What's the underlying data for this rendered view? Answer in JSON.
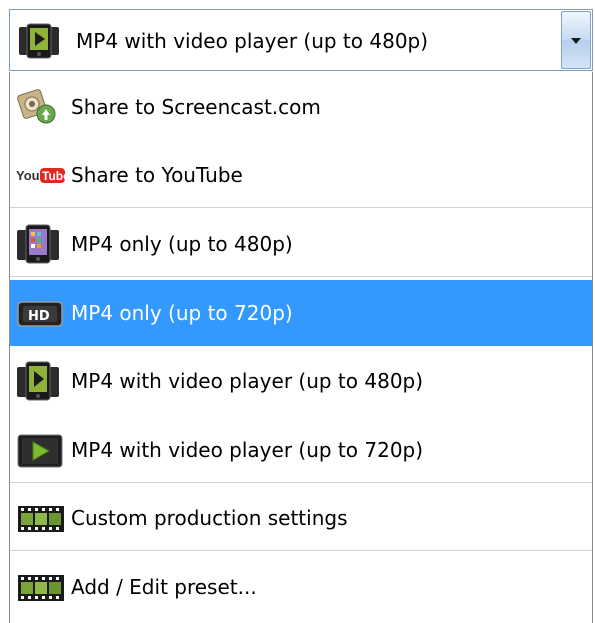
{
  "combo": {
    "selected_label": "MP4 with video player (up to 480p)",
    "selected_icon": "phone-player-icon"
  },
  "dropdown": {
    "items": [
      {
        "label": "Share to Screencast.com",
        "icon": "screencast-icon",
        "selected": false
      },
      {
        "label": "Share to YouTube",
        "icon": "youtube-icon",
        "selected": false
      },
      {
        "label": "MP4 only (up to 480p)",
        "icon": "phone-icon",
        "selected": false
      },
      {
        "label": "MP4 only (up to 720p)",
        "icon": "hd-icon",
        "selected": true
      },
      {
        "label": "MP4 with video player (up to 480p)",
        "icon": "phone-player-icon",
        "selected": false
      },
      {
        "label": "MP4 with video player (up to 720p)",
        "icon": "play-icon",
        "selected": false
      },
      {
        "label": "Custom production settings",
        "icon": "film-strip-icon",
        "selected": false
      },
      {
        "label": "Add / Edit preset...",
        "icon": "film-strip-icon",
        "selected": false
      }
    ]
  },
  "colors": {
    "highlight": "#3399ff",
    "highlight_text": "#ffffff",
    "separator": "#d2d2d2",
    "border": "#7f9db9"
  }
}
